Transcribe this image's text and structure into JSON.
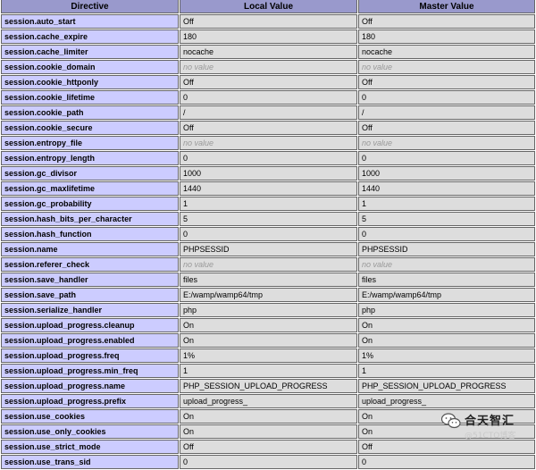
{
  "table": {
    "headers": [
      "Directive",
      "Local Value",
      "Master Value"
    ],
    "rows": [
      {
        "directive": "session.auto_start",
        "local": "Off",
        "master": "Off",
        "local_novalue": false,
        "master_novalue": false
      },
      {
        "directive": "session.cache_expire",
        "local": "180",
        "master": "180",
        "local_novalue": false,
        "master_novalue": false
      },
      {
        "directive": "session.cache_limiter",
        "local": "nocache",
        "master": "nocache",
        "local_novalue": false,
        "master_novalue": false
      },
      {
        "directive": "session.cookie_domain",
        "local": "no value",
        "master": "no value",
        "local_novalue": true,
        "master_novalue": true
      },
      {
        "directive": "session.cookie_httponly",
        "local": "Off",
        "master": "Off",
        "local_novalue": false,
        "master_novalue": false
      },
      {
        "directive": "session.cookie_lifetime",
        "local": "0",
        "master": "0",
        "local_novalue": false,
        "master_novalue": false
      },
      {
        "directive": "session.cookie_path",
        "local": "/",
        "master": "/",
        "local_novalue": false,
        "master_novalue": false
      },
      {
        "directive": "session.cookie_secure",
        "local": "Off",
        "master": "Off",
        "local_novalue": false,
        "master_novalue": false
      },
      {
        "directive": "session.entropy_file",
        "local": "no value",
        "master": "no value",
        "local_novalue": true,
        "master_novalue": true
      },
      {
        "directive": "session.entropy_length",
        "local": "0",
        "master": "0",
        "local_novalue": false,
        "master_novalue": false
      },
      {
        "directive": "session.gc_divisor",
        "local": "1000",
        "master": "1000",
        "local_novalue": false,
        "master_novalue": false
      },
      {
        "directive": "session.gc_maxlifetime",
        "local": "1440",
        "master": "1440",
        "local_novalue": false,
        "master_novalue": false
      },
      {
        "directive": "session.gc_probability",
        "local": "1",
        "master": "1",
        "local_novalue": false,
        "master_novalue": false
      },
      {
        "directive": "session.hash_bits_per_character",
        "local": "5",
        "master": "5",
        "local_novalue": false,
        "master_novalue": false
      },
      {
        "directive": "session.hash_function",
        "local": "0",
        "master": "0",
        "local_novalue": false,
        "master_novalue": false
      },
      {
        "directive": "session.name",
        "local": "PHPSESSID",
        "master": "PHPSESSID",
        "local_novalue": false,
        "master_novalue": false
      },
      {
        "directive": "session.referer_check",
        "local": "no value",
        "master": "no value",
        "local_novalue": true,
        "master_novalue": true
      },
      {
        "directive": "session.save_handler",
        "local": "files",
        "master": "files",
        "local_novalue": false,
        "master_novalue": false
      },
      {
        "directive": "session.save_path",
        "local": "E:/wamp/wamp64/tmp",
        "master": "E:/wamp/wamp64/tmp",
        "local_novalue": false,
        "master_novalue": false
      },
      {
        "directive": "session.serialize_handler",
        "local": "php",
        "master": "php",
        "local_novalue": false,
        "master_novalue": false
      },
      {
        "directive": "session.upload_progress.cleanup",
        "local": "On",
        "master": "On",
        "local_novalue": false,
        "master_novalue": false
      },
      {
        "directive": "session.upload_progress.enabled",
        "local": "On",
        "master": "On",
        "local_novalue": false,
        "master_novalue": false
      },
      {
        "directive": "session.upload_progress.freq",
        "local": "1%",
        "master": "1%",
        "local_novalue": false,
        "master_novalue": false
      },
      {
        "directive": "session.upload_progress.min_freq",
        "local": "1",
        "master": "1",
        "local_novalue": false,
        "master_novalue": false
      },
      {
        "directive": "session.upload_progress.name",
        "local": "PHP_SESSION_UPLOAD_PROGRESS",
        "master": "PHP_SESSION_UPLOAD_PROGRESS",
        "local_novalue": false,
        "master_novalue": false
      },
      {
        "directive": "session.upload_progress.prefix",
        "local": "upload_progress_",
        "master": "upload_progress_",
        "local_novalue": false,
        "master_novalue": false
      },
      {
        "directive": "session.use_cookies",
        "local": "On",
        "master": "On",
        "local_novalue": false,
        "master_novalue": false
      },
      {
        "directive": "session.use_only_cookies",
        "local": "On",
        "master": "On",
        "local_novalue": false,
        "master_novalue": false
      },
      {
        "directive": "session.use_strict_mode",
        "local": "Off",
        "master": "Off",
        "local_novalue": false,
        "master_novalue": false
      },
      {
        "directive": "session.use_trans_sid",
        "local": "0",
        "master": "0",
        "local_novalue": false,
        "master_novalue": false
      }
    ]
  },
  "watermark": {
    "brand": "合天智汇",
    "sub": "@51CTO博客",
    "icon": "wechat-icon"
  },
  "colors": {
    "header_bg": "#9999cc",
    "directive_bg": "#ccccff",
    "value_bg": "#dddddd",
    "novalue_text": "#999999"
  }
}
